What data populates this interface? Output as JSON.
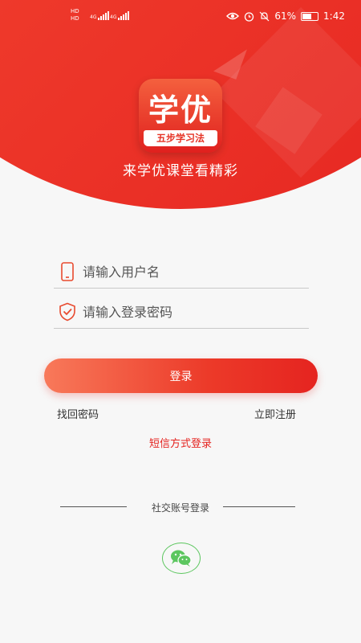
{
  "status_bar": {
    "hd1": "HD",
    "hd2": "HD",
    "net1": "4G",
    "net2": "4G",
    "battery_percent": "61%",
    "time": "1:42",
    "icons": [
      "eye-icon",
      "alarm-icon",
      "mute-icon",
      "battery-icon"
    ]
  },
  "header": {
    "logo_title": "学优",
    "logo_subtitle": "五步学习法",
    "tagline": "来学优课堂看精彩"
  },
  "form": {
    "username_placeholder": "请输入用户名",
    "password_placeholder": "请输入登录密码",
    "username_icon": "phone-icon",
    "password_icon": "shield-check-icon"
  },
  "actions": {
    "login_label": "登录",
    "forgot_password": "找回密码",
    "register": "立即注册",
    "sms_login": "短信方式登录"
  },
  "social": {
    "label": "社交账号登录",
    "providers": [
      "wechat-icon"
    ]
  },
  "colors": {
    "brand_red": "#e52420",
    "brand_orange": "#f8795a",
    "wechat_green": "#5cc65f"
  }
}
